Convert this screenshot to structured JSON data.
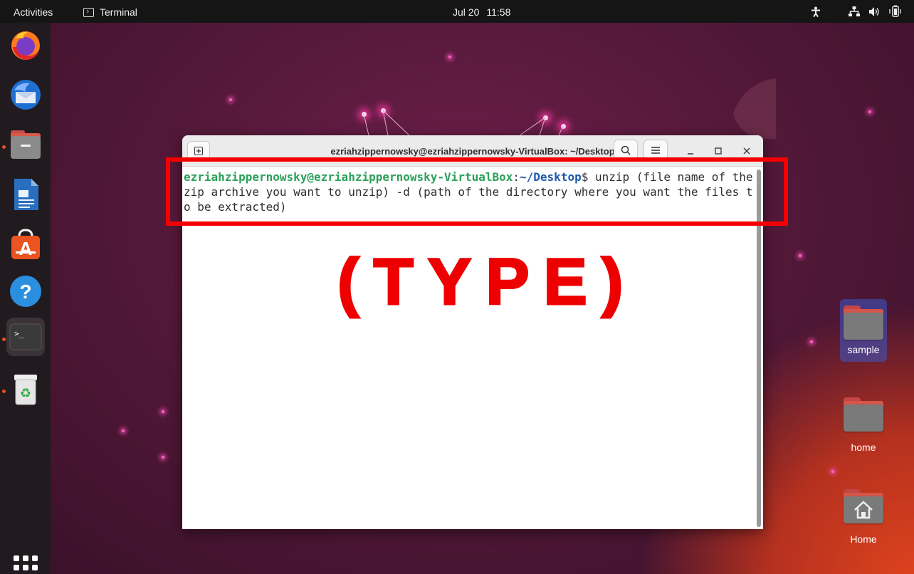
{
  "topbar": {
    "activities": "Activities",
    "app_name": "Terminal",
    "date": "Jul 20",
    "time": "11:58",
    "tray_icons": [
      "accessibility-icon",
      "network-icon",
      "volume-icon",
      "battery-icon"
    ]
  },
  "dock": {
    "items": [
      {
        "name": "firefox",
        "running": false
      },
      {
        "name": "thunderbird",
        "running": false
      },
      {
        "name": "files",
        "running": true
      },
      {
        "name": "libreoffice-writer",
        "running": false
      },
      {
        "name": "app-center",
        "running": false
      },
      {
        "name": "help",
        "running": false
      },
      {
        "name": "terminal",
        "running": true,
        "active": true
      },
      {
        "name": "trash",
        "running": true
      }
    ],
    "show_apps": "apps-grid-icon"
  },
  "terminal": {
    "title": "ezriahzippernowsky@ezriahzippernowsky-VirtualBox: ~/Desktop",
    "prompt_user": "ezriahzippernowsky@ezriahzippernowsky-VirtualBox",
    "prompt_sep": ":",
    "prompt_path": "~/Desktop",
    "prompt_dollar": "$",
    "command": " unzip (file name of the zip archive you want to unzip) -d (path of the directory where you want the files to be extracted)"
  },
  "annotation": {
    "label": "(TYPE)",
    "color": "#f40000"
  },
  "desktop_icons": [
    {
      "label": "sample",
      "selected": true
    },
    {
      "label": "home",
      "selected": false
    },
    {
      "label": "Home",
      "selected": false
    }
  ]
}
